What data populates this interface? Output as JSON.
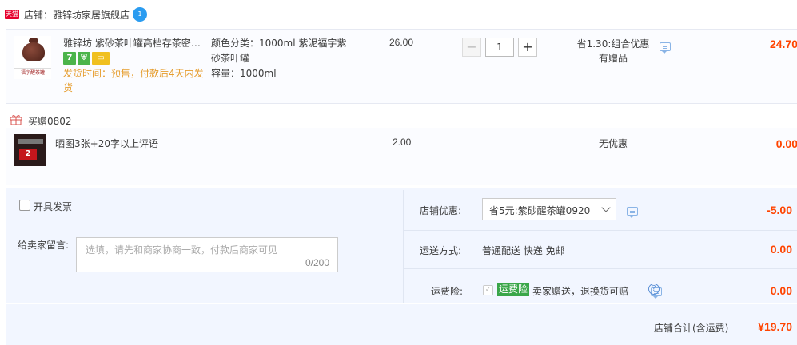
{
  "shop": {
    "platform_badge": "天猫",
    "label": "店铺：雅锌坊家居旗舰店",
    "chat_badge": "1"
  },
  "item": {
    "title": "雅锌坊 紫砂茶叶罐高档存茶密封罐",
    "thumb_caption": "福字醒茶罐",
    "badges": [
      "7",
      "shield",
      "card"
    ],
    "ship_time": "发货时间：预售，付款后4天内发货",
    "sku_color": "颜色分类：1000ml 紫泥福字紫砂茶叶罐",
    "sku_capacity": "容量：1000ml",
    "price": "26.00",
    "quantity": "1",
    "qty_minus": "−",
    "qty_plus": "+",
    "discount_line1": "省1.30:组合优惠",
    "discount_line2": "有赠品",
    "subtotal": "24.70"
  },
  "gift": {
    "header": "买赠0802",
    "thumb_text": "2",
    "title": "晒图3张+20字以上评语",
    "price": "2.00",
    "discount": "无优惠",
    "subtotal": "0.00"
  },
  "invoice": {
    "label": "开具发票",
    "checked": false
  },
  "message": {
    "label": "给卖家留言:",
    "placeholder": "选填，请先和商家协商一致，付款后商家可见",
    "counter": "0/200"
  },
  "promo": {
    "label": "店铺优惠:",
    "selected": "省5元:紫砂醒茶罐0920",
    "amount": "-5.00"
  },
  "shipping": {
    "label": "运送方式:",
    "value": "普通配送 快递 免邮",
    "amount": "0.00"
  },
  "insurance": {
    "label": "运费险:",
    "tag": "运费险",
    "text": "卖家赠送，退换货可赔",
    "help": "?",
    "amount": "0.00"
  },
  "total": {
    "label": "店铺合计(含运费)",
    "amount": "¥19.70"
  },
  "colors": {
    "accent_red": "#ff4400",
    "panel_bg": "#f2f6ff",
    "ship_time_orange": "#e69d2e",
    "insurance_green": "#3aa649"
  }
}
